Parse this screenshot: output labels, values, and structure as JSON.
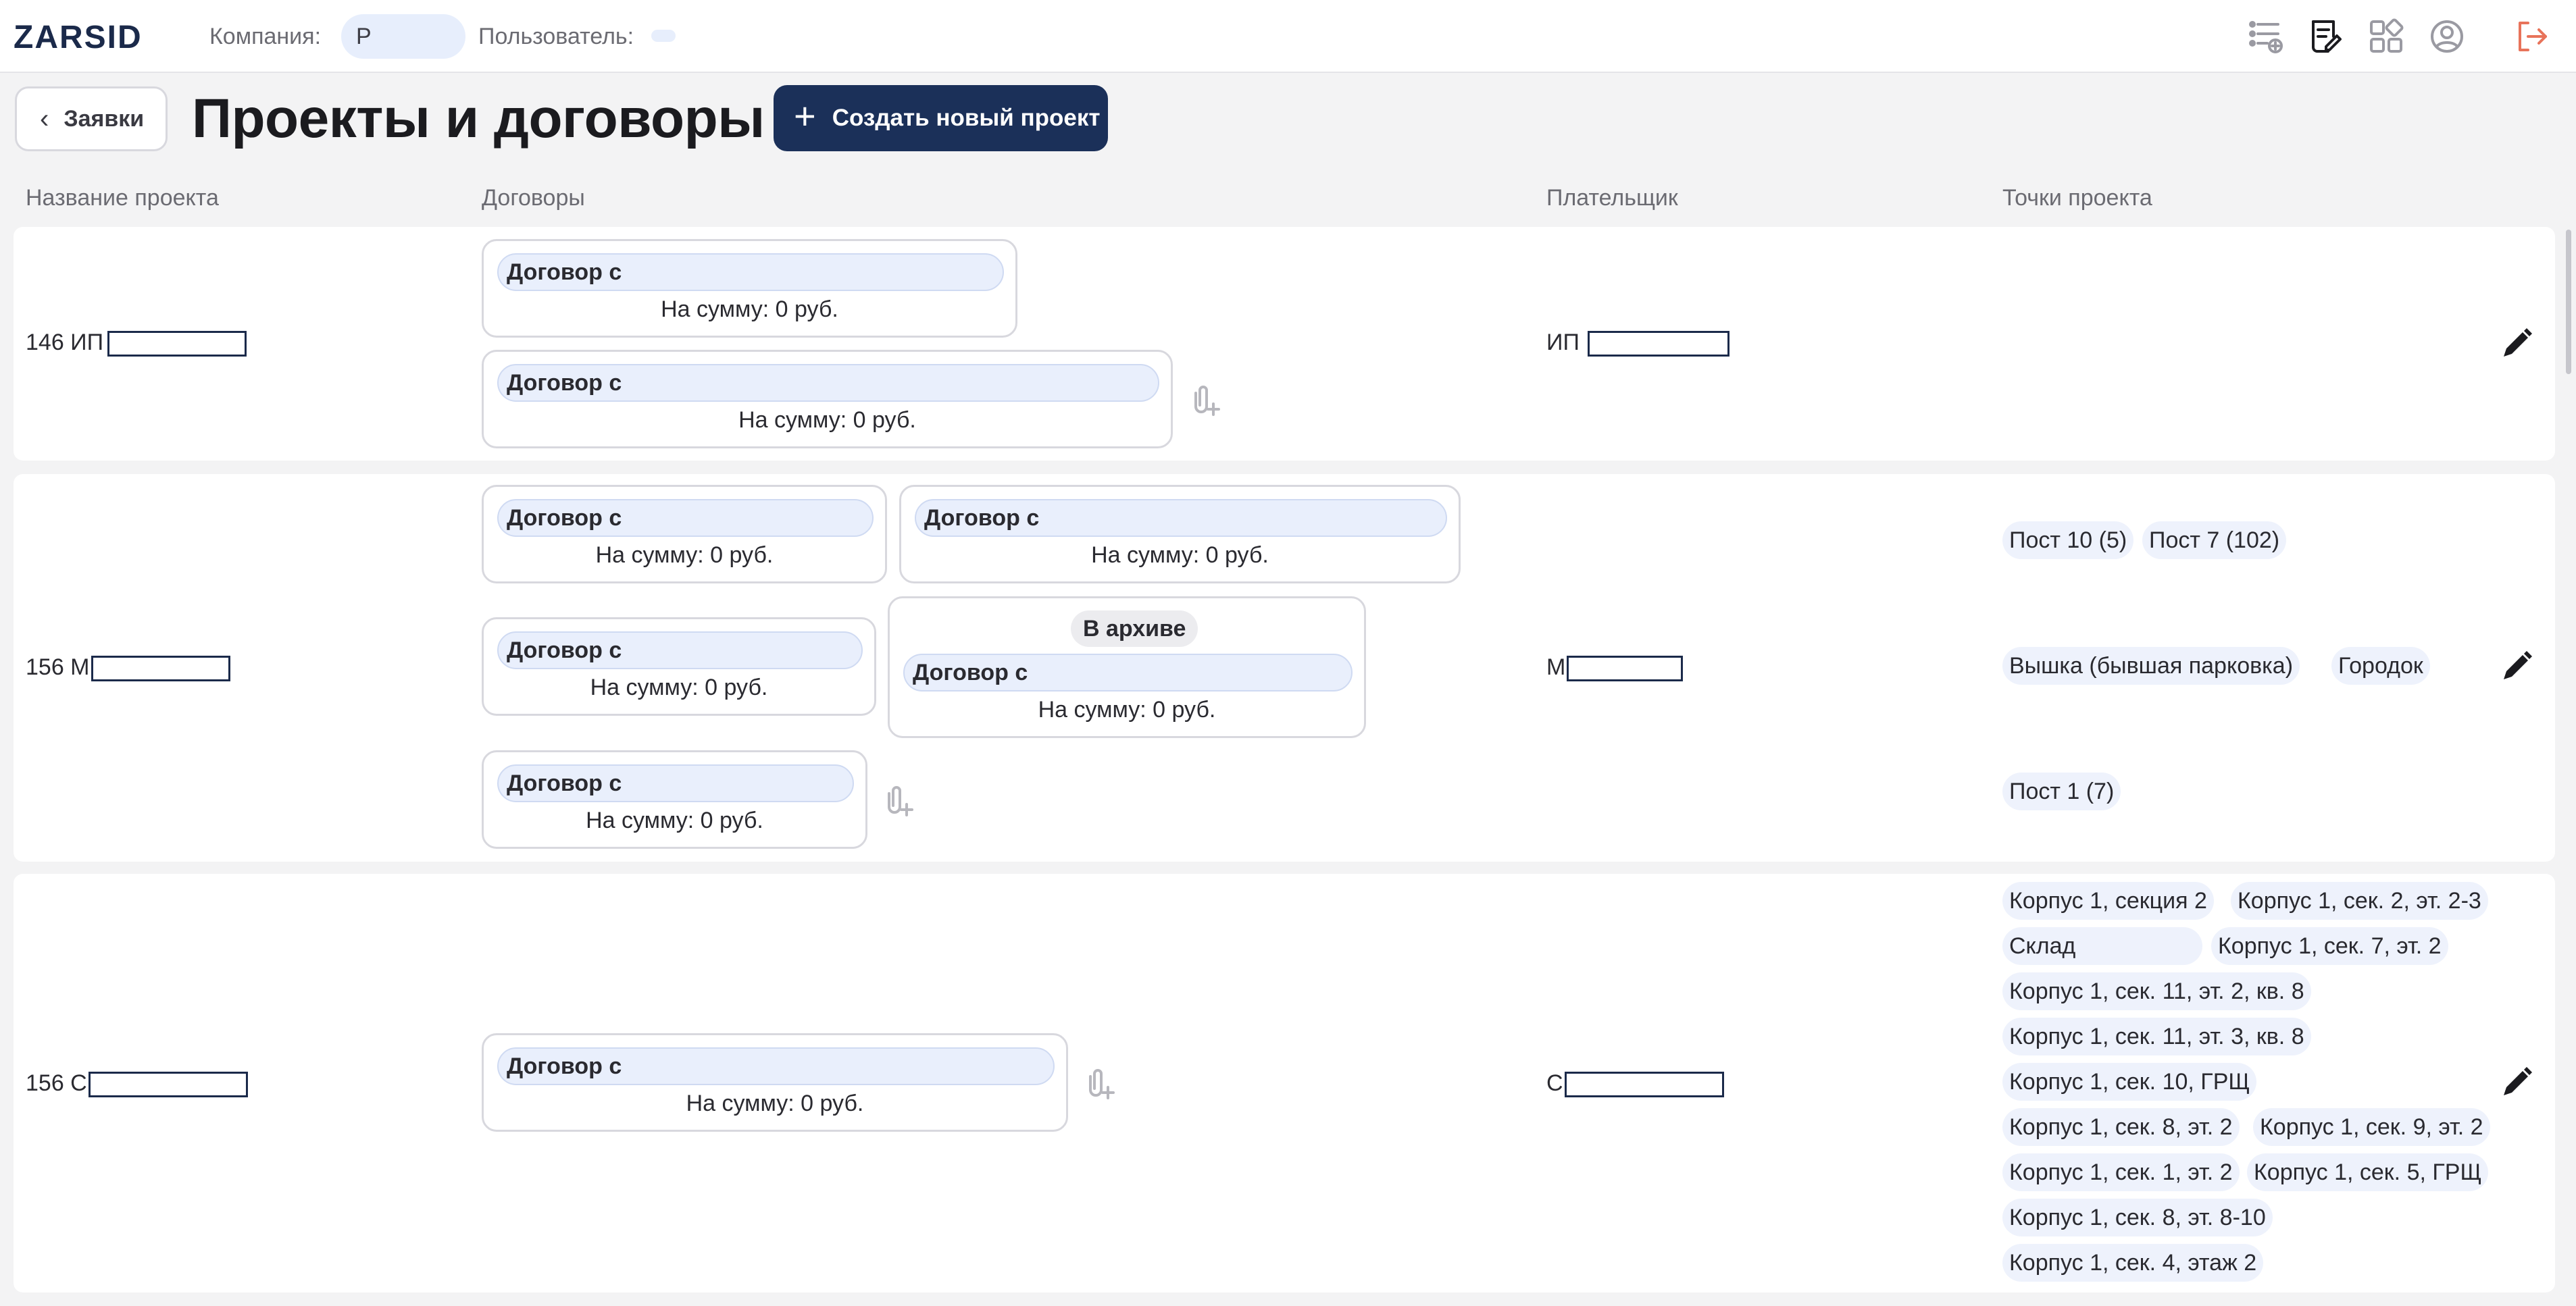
{
  "app": {
    "logo": "ZARSID"
  },
  "header": {
    "company_label": "Компания:",
    "company_value": "Р",
    "user_label": "Пользователь:",
    "user_value": "",
    "icons": [
      "tasks-icon",
      "contracts-edit-icon",
      "modules-icon",
      "profile-icon",
      "logout-icon"
    ]
  },
  "toolbar": {
    "back_label": "Заявки",
    "title": "Проекты и договоры",
    "create_label": "Создать новый проект"
  },
  "columns": [
    "Название проекта",
    "Договоры",
    "Плательщик",
    "Точки проекта"
  ],
  "rows": [
    {
      "name": "146 ИП",
      "payer": "ИП",
      "contracts": [
        {
          "label": "Договор с",
          "sum": "На сумму: 0 руб."
        },
        {
          "label": "Договор с",
          "sum": "На сумму: 0 руб."
        }
      ],
      "points": []
    },
    {
      "name": "156 М",
      "payer": "М",
      "contracts": [
        {
          "label": "Договор с",
          "sum": "На сумму: 0 руб."
        },
        {
          "label": "Договор с",
          "sum": "На сумму: 0 руб."
        },
        {
          "label": "Договор с",
          "sum": "На сумму: 0 руб."
        },
        {
          "label": "Договор с",
          "sum": "На сумму: 0 руб.",
          "status": "В архиве"
        },
        {
          "label": "Договор с",
          "sum": "На сумму: 0 руб."
        }
      ],
      "points": [
        "Пост 10 (5)",
        "Пост 7 (102)",
        "Вышка (бывшая парковка)",
        "Городок",
        "Пост 1 (7)"
      ]
    },
    {
      "name": "156 С",
      "payer": "С",
      "contracts": [
        {
          "label": "Договор с",
          "sum": "На сумму: 0 руб."
        }
      ],
      "points": [
        "Корпус 1, секция 2",
        "Корпус 1, сек. 2, эт. 2-3",
        "Склад",
        "Корпус 1, сек. 7, эт. 2",
        "Корпус 1, сек. 11, эт. 2, кв. 8",
        "Корпус 1, сек. 11, эт. 3, кв. 8",
        "Корпус 1, сек. 10, ГРЩ",
        "Корпус 1, сек. 8, эт. 2",
        "Корпус 1, сек. 9, эт. 2",
        "Корпус 1, сек. 1, эт. 2",
        "Корпус 1, сек. 5, ГРЩ",
        "Корпус 1, сек. 8, эт. 8-10",
        "Корпус 1, сек. 4, этаж 2"
      ]
    }
  ],
  "colors": {
    "primary": "#1b3059",
    "chip_bg": "#e9effc",
    "page_bg": "#f3f3f4",
    "logout": "#e8735a"
  }
}
